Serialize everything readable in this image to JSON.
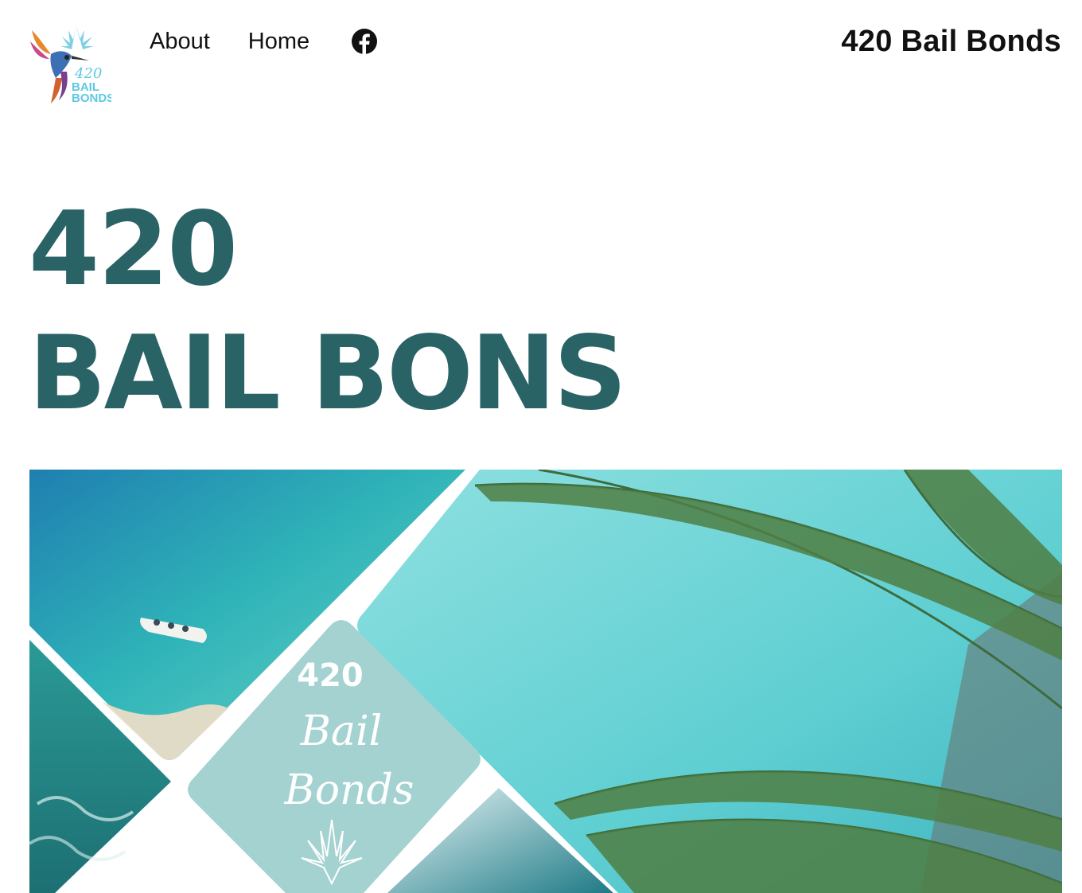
{
  "header": {
    "nav": [
      "About",
      "Home"
    ],
    "facebook_icon": "facebook-icon",
    "site_title": "420 Bail Bonds",
    "logo": {
      "top_text": "420",
      "line1": "BAIL",
      "line2": "BONDS",
      "icon": "hummingbird-cannabis-logo"
    }
  },
  "hero": {
    "line1": "420",
    "line2": "BAIL BONS"
  },
  "banner": {
    "badge_number": "420",
    "badge_script1": "Bail",
    "badge_script2": "Bonds",
    "leaf_icon": "cannabis-leaf-icon"
  },
  "colors": {
    "heading": "#2a6366",
    "logo_text": "#5ec8e0",
    "badge_bg": "#a3d2d0"
  }
}
